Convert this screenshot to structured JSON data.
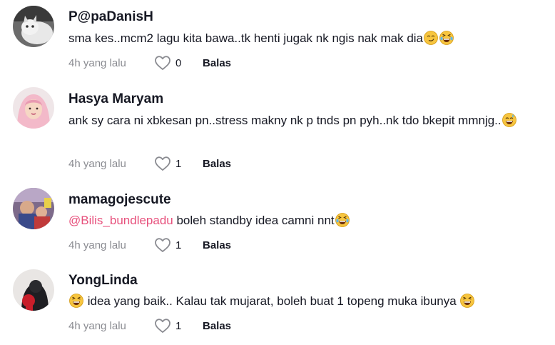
{
  "comments": [
    {
      "username": "P@paDanisH",
      "text": "sma kes..mcm2 lagu kita bawa..tk henti jugak nk ngis nak mak dia",
      "time": "4h yang lalu",
      "likes": "0",
      "reply_label": "Balas"
    },
    {
      "username": "Hasya Maryam",
      "text": "ank sy cara ni xbkesan pn..stress makny nk p tnds pn pyh..nk tdo bkepit mmnjg..",
      "time": "4h yang lalu",
      "likes": "1",
      "reply_label": "Balas"
    },
    {
      "username": "mamagojescute",
      "mention": "@Bilis_bundlepadu",
      "text": " boleh standby idea camni nnt",
      "time": "4h yang lalu",
      "likes": "1",
      "reply_label": "Balas"
    },
    {
      "username": "YongLinda",
      "text": " idea yang baik.. Kalau tak mujarat, boleh buat 1 topeng muka ibunya ",
      "time": "4h yang lalu",
      "likes": "1",
      "reply_label": "Balas"
    }
  ],
  "icons": {
    "like": "heart-outline-icon",
    "emojis": [
      "smirk-emoji",
      "laughing-tears-emoji",
      "sweat-smile-emoji",
      "laughing-tears-emoji",
      "grinning-squint-emoji"
    ]
  },
  "colors": {
    "mention": "#e7507c",
    "meta": "#8a8b91",
    "text": "#161823"
  }
}
